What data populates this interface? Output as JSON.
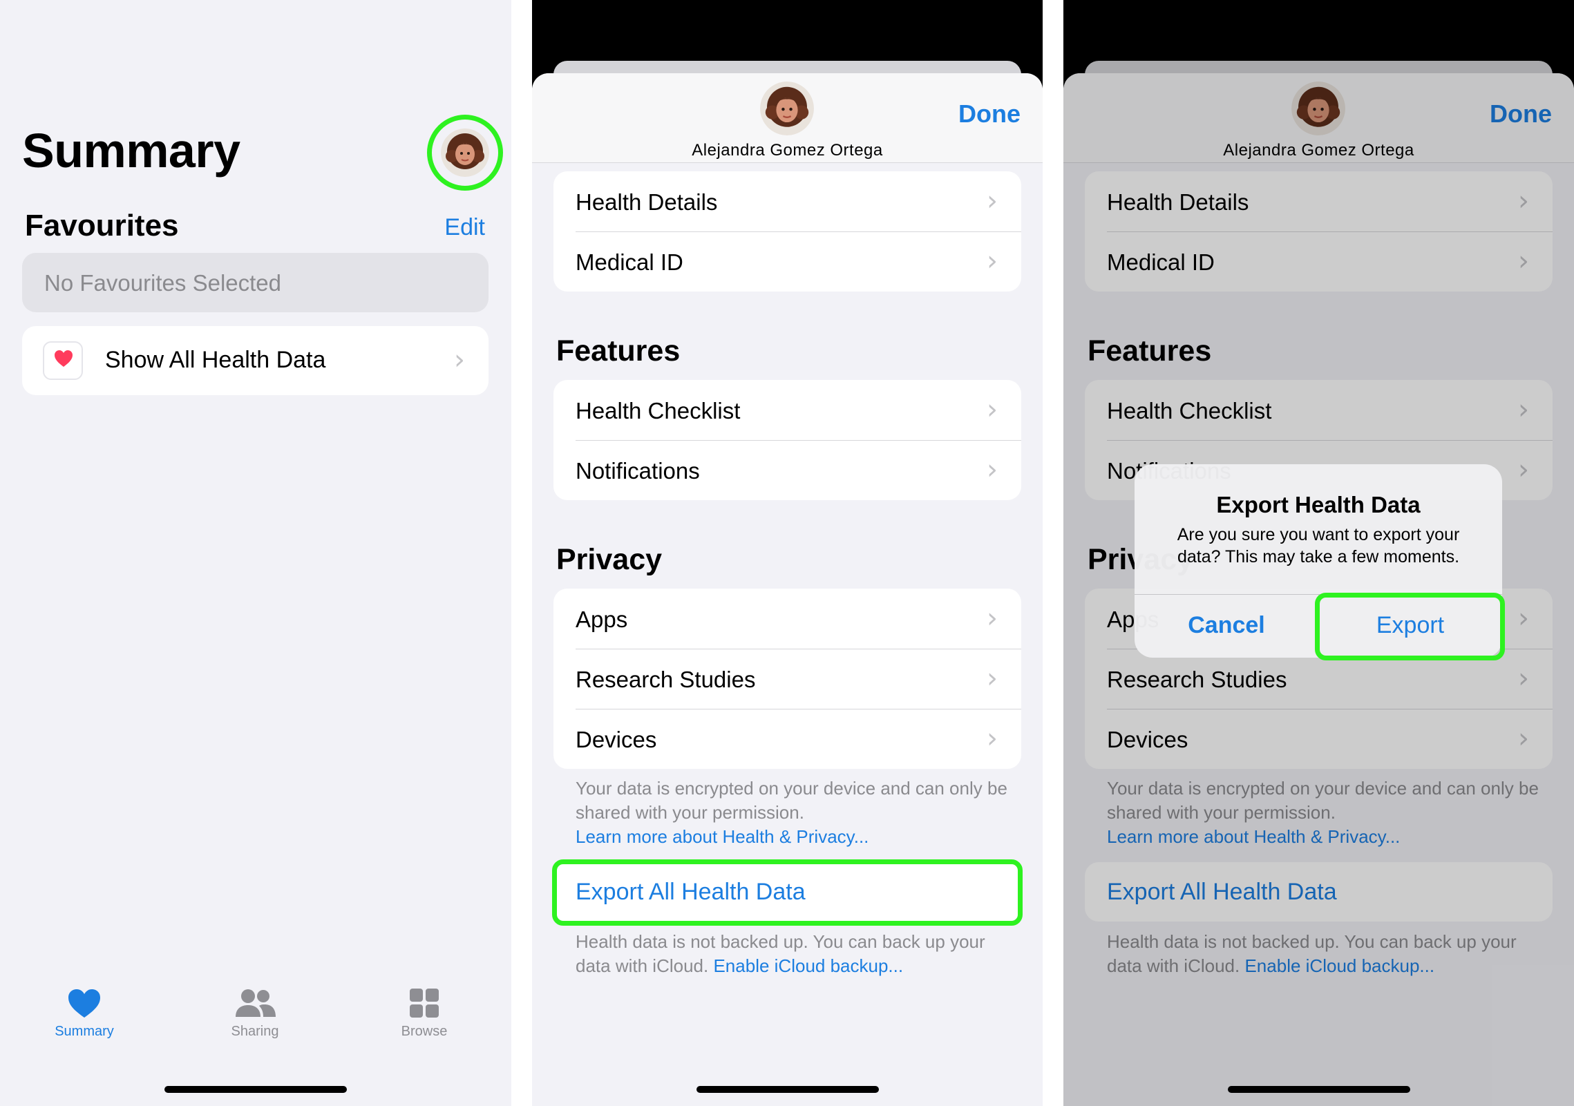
{
  "colors": {
    "accent": "#1c7ee0",
    "highlight": "#2ef220",
    "heart": "#ff3b5c"
  },
  "summary": {
    "title": "Summary",
    "favourites_title": "Favourites",
    "edit_label": "Edit",
    "no_favourites": "No Favourites Selected",
    "show_all_label": "Show All Health Data",
    "tabs": [
      {
        "label": "Summary",
        "icon": "heart-icon",
        "active": true
      },
      {
        "label": "Sharing",
        "icon": "people-icon",
        "active": false
      },
      {
        "label": "Browse",
        "icon": "grid-icon",
        "active": false
      }
    ]
  },
  "profile": {
    "name": "Alejandra Gomez Ortega",
    "done_label": "Done",
    "health_rows": [
      "Health Details",
      "Medical ID"
    ],
    "features_title": "Features",
    "features_rows": [
      "Health Checklist",
      "Notifications"
    ],
    "privacy_title": "Privacy",
    "privacy_rows": [
      "Apps",
      "Research Studies",
      "Devices"
    ],
    "privacy_note": "Your data is encrypted on your device and can only be shared with your permission.",
    "privacy_link": "Learn more about Health & Privacy...",
    "export_label": "Export All Health Data",
    "backup_note": "Health data is not backed up. You can back up your data with iCloud.",
    "backup_link": "Enable iCloud backup..."
  },
  "alert": {
    "title": "Export Health Data",
    "message": "Are you sure you want to export your data? This may take a few moments.",
    "cancel_label": "Cancel",
    "export_label": "Export"
  }
}
